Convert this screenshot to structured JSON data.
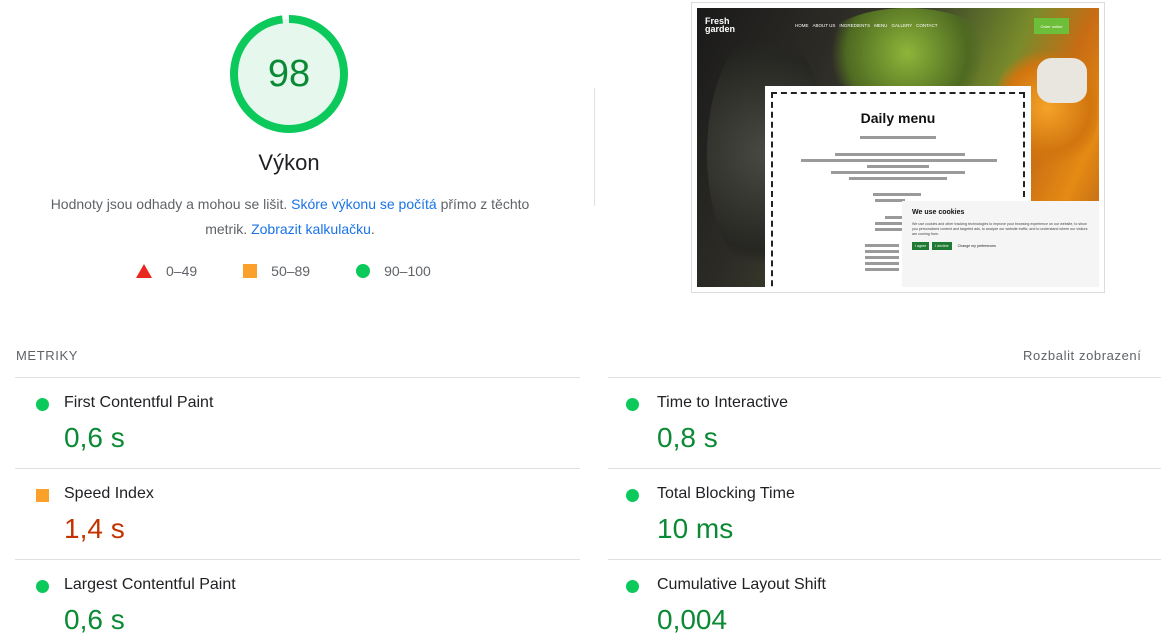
{
  "score": {
    "value": "98",
    "fraction": 0.98,
    "title": "Výkon",
    "desc_part1": "Hodnoty jsou odhady a mohou se lišit. ",
    "desc_link1": "Skóre výkonu se počítá",
    "desc_part2": " přímo z těchto metrik. ",
    "desc_link2": "Zobrazit kalkulačku",
    "desc_part3": "."
  },
  "legend": [
    {
      "range": "0–49",
      "shape": "triangle",
      "color": "#e8281f"
    },
    {
      "range": "50–89",
      "shape": "square",
      "color": "#fba02a"
    },
    {
      "range": "90–100",
      "shape": "circle",
      "color": "#0bc95a"
    }
  ],
  "screenshot": {
    "logo_line1": "Fresh",
    "logo_line2": "garden",
    "nav": [
      "HOME",
      "ABOUT US",
      "INGREDIENTS",
      "MENU",
      "GALLERY",
      "CONTACT"
    ],
    "order_button": "Order online",
    "menu_title": "Daily menu",
    "cookie_title": "We use cookies",
    "cookie_text": "We use cookies and other tracking technologies to improve your browsing experience on our website, to show you personalized content and targeted ads, to analyze our website traffic, and to understand where our visitors are coming from.",
    "cookie_agree": "I agree",
    "cookie_decline": "I decline",
    "cookie_prefs": "Change my preferences"
  },
  "metrics_section": {
    "label": "METRIKY",
    "expand": "Rozbalit zobrazení"
  },
  "metrics": [
    {
      "title": "First Contentful Paint",
      "value": "0,6 s",
      "status": "good"
    },
    {
      "title": "Time to Interactive",
      "value": "0,8 s",
      "status": "good"
    },
    {
      "title": "Speed Index",
      "value": "1,4 s",
      "status": "average"
    },
    {
      "title": "Total Blocking Time",
      "value": "10 ms",
      "status": "good"
    },
    {
      "title": "Largest Contentful Paint",
      "value": "0,6 s",
      "status": "good"
    },
    {
      "title": "Cumulative Layout Shift",
      "value": "0,004",
      "status": "good"
    }
  ],
  "colors": {
    "good": "#0bc95a",
    "good_text": "#0b8a35",
    "average": "#fba02a",
    "average_text": "#c33300",
    "poor": "#e8281f",
    "link": "#1a73e8"
  }
}
